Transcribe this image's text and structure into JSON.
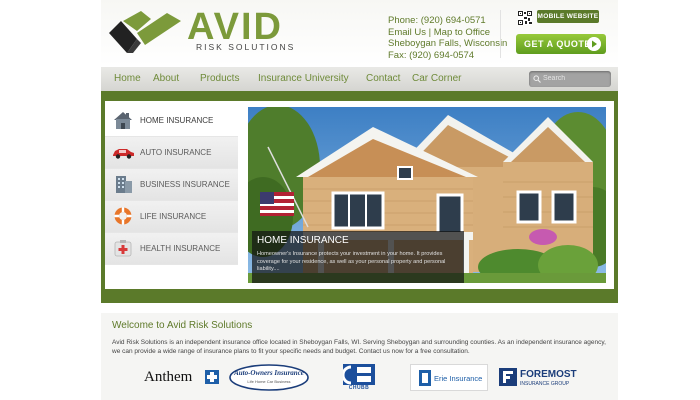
{
  "brand": {
    "name": "AVID",
    "tagline": "RISK SOLUTIONS",
    "color_primary": "#7c9a3b",
    "color_dark": "#5b7a2a",
    "color_cta": "#7bb52c"
  },
  "contact": {
    "phone": "Phone: (920) 694-0571",
    "links": "Email Us | Map to Office",
    "location": "Sheboygan Falls, Wisconsin",
    "fax": "Fax: (920) 694-0574"
  },
  "header_actions": {
    "qr_icon": "qr-code-icon",
    "mobile_label": "MOBILE WEBSITE",
    "quote_label": "GET A QUOTE",
    "quote_icon": "arrow-right-icon"
  },
  "nav": {
    "items": [
      "Home",
      "About",
      "Products",
      "Insurance University",
      "Contact",
      "Car Corner"
    ],
    "search_placeholder": "Search",
    "search_icon": "search-icon"
  },
  "side_menu": {
    "items": [
      {
        "label": "HOME INSURANCE",
        "icon": "house-icon"
      },
      {
        "label": "AUTO INSURANCE",
        "icon": "car-icon"
      },
      {
        "label": "BUSINESS INSURANCE",
        "icon": "building-icon"
      },
      {
        "label": "LIFE INSURANCE",
        "icon": "life-ring-icon"
      },
      {
        "label": "HEALTH INSURANCE",
        "icon": "medical-kit-icon"
      }
    ],
    "active_index": 0
  },
  "hero": {
    "caption_title": "HOME INSURANCE",
    "caption_text": "Homeowner's Insurance protects your investment in your home. It provides coverage for your residence, as well as your personal property and personal liability...."
  },
  "welcome": {
    "title": "Welcome to Avid Risk Solutions",
    "text": "Avid Risk Solutions is an independent insurance office located in Sheboygan Falls, WI. Serving Sheboygan and surrounding counties. As an independent insurance agency, we can provide a wide range of insurance plans to fit your specific needs and budget.  Contact us now for a free consultation."
  },
  "partners": {
    "anthem": "Anthem",
    "auto_owners": "Auto-Owners Insurance",
    "auto_owners_sub": "Life Home Car Business",
    "chubb": "CHUBB",
    "erie": "Erie Insurance",
    "foremost": "FOREMOST",
    "foremost_sub": "INSURANCE GROUP"
  }
}
